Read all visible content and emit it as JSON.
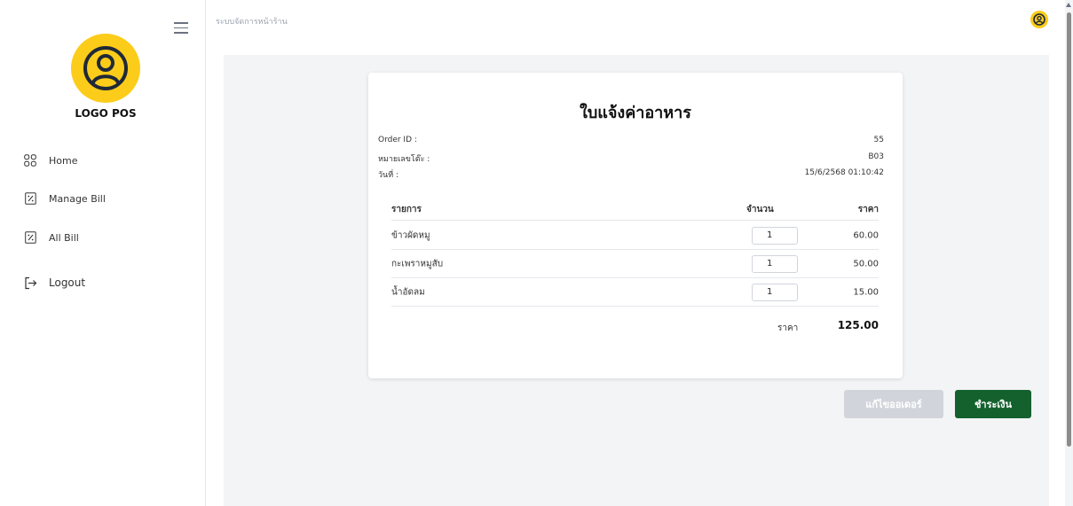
{
  "sidebar": {
    "logo_text": "LOGO POS",
    "items": [
      {
        "label": "Home",
        "icon": "grid-icon"
      },
      {
        "label": "Manage Bill",
        "icon": "receipt-icon"
      },
      {
        "label": "All Bill",
        "icon": "receipt-icon"
      },
      {
        "label": "Logout",
        "icon": "logout-icon"
      }
    ]
  },
  "topbar": {
    "title": "ระบบจัดการหน้าร้าน"
  },
  "receipt": {
    "title": "ใบแจ้งค่าอาหาร",
    "order_id_label": "Order ID :",
    "order_id_value": "55",
    "table_label": "หมายเลขโต๊ะ :",
    "table_value": "B03",
    "date_label": "วันที่ :",
    "date_value": "15/6/2568 01:10:42",
    "columns": {
      "item": "รายการ",
      "qty": "จำนวน",
      "price": "ราคา"
    },
    "items": [
      {
        "name": "ข้าวผัดหมู",
        "qty": "1",
        "price": "60.00"
      },
      {
        "name": "กะเพราหมูสับ",
        "qty": "1",
        "price": "50.00"
      },
      {
        "name": "น้ำอัดลม",
        "qty": "1",
        "price": "15.00"
      }
    ],
    "total_label": "ราคา",
    "total_value": "125.00"
  },
  "actions": {
    "edit_label": "แก้ไขออเดอร์",
    "pay_label": "ชำระเงิน"
  },
  "colors": {
    "accent": "#fccc1a",
    "pay_button": "#14612e",
    "edit_button": "#d1d5db"
  }
}
